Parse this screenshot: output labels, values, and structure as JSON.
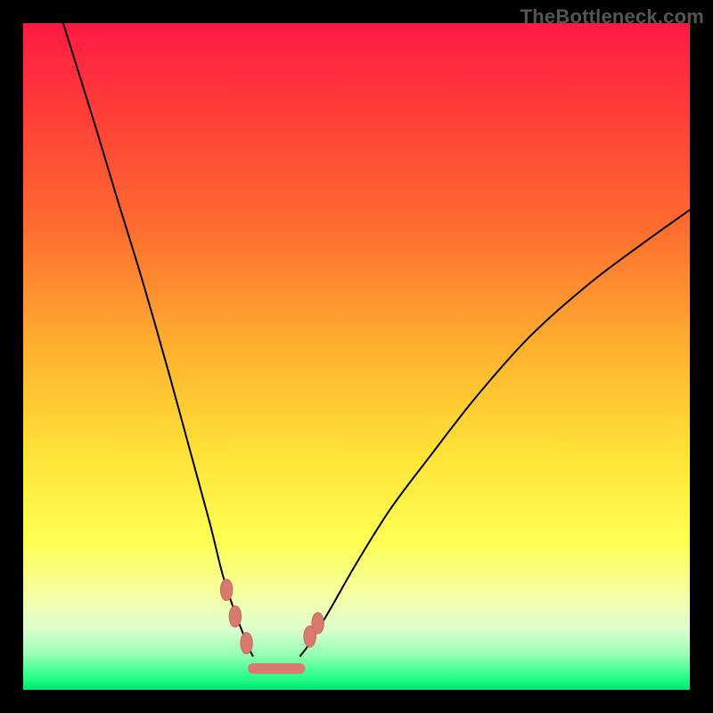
{
  "watermark": "TheBottleneck.com",
  "colors": {
    "frame_border": "#000000",
    "curve_stroke": "#000000",
    "marker_fill": "#d87a6e",
    "marker_stroke": "#c86a5e"
  },
  "chart_data": {
    "type": "line",
    "title": "",
    "xlabel": "",
    "ylabel": "",
    "xlim": [
      0,
      100
    ],
    "ylim": [
      0,
      100
    ],
    "gradient_stops": [
      {
        "pct": 0,
        "color": "#ff1a44"
      },
      {
        "pct": 12,
        "color": "#ff3a3a"
      },
      {
        "pct": 30,
        "color": "#ff6a2f"
      },
      {
        "pct": 50,
        "color": "#ffb530"
      },
      {
        "pct": 65,
        "color": "#ffe438"
      },
      {
        "pct": 78,
        "color": "#ffff55"
      },
      {
        "pct": 86,
        "color": "#f6ffa6"
      },
      {
        "pct": 91,
        "color": "#dcffd0"
      },
      {
        "pct": 95,
        "color": "#8fffb0"
      },
      {
        "pct": 98,
        "color": "#2bff8a"
      },
      {
        "pct": 100,
        "color": "#00e56f"
      }
    ],
    "series": [
      {
        "name": "left-arm",
        "x": [
          6,
          11,
          14,
          18,
          22,
          25,
          28,
          30,
          32,
          34,
          34.5
        ],
        "values": [
          100,
          84,
          74,
          61,
          47,
          36,
          25,
          17,
          11,
          6,
          5
        ]
      },
      {
        "name": "right-arm",
        "x": [
          41.5,
          43,
          46,
          50,
          55,
          61,
          68,
          76,
          85,
          93,
          100
        ],
        "values": [
          5,
          7,
          12,
          19,
          27,
          35,
          44,
          53,
          61,
          67,
          72
        ]
      },
      {
        "name": "valley-flat",
        "x": [
          34.5,
          41.5
        ],
        "values": [
          3,
          3
        ]
      }
    ],
    "markers": [
      {
        "series": "left-arm",
        "x": 30.5,
        "y": 15
      },
      {
        "series": "left-arm",
        "x": 31.8,
        "y": 11
      },
      {
        "series": "left-arm",
        "x": 33.5,
        "y": 7
      },
      {
        "series": "right-arm",
        "x": 43.0,
        "y": 8
      },
      {
        "series": "right-arm",
        "x": 44.2,
        "y": 10
      }
    ],
    "flat_segment": {
      "x0": 34.5,
      "y0": 3.2,
      "x1": 41.5,
      "y1": 3.2
    }
  }
}
